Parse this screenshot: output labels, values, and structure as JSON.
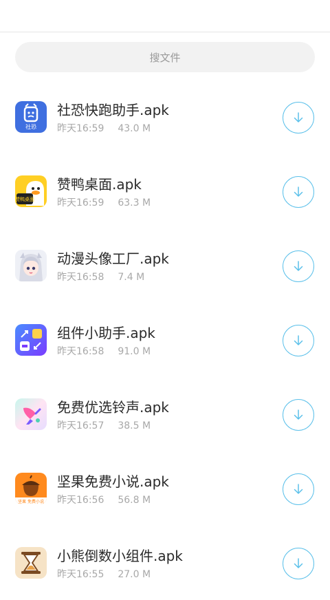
{
  "search": {
    "placeholder": "搜文件"
  },
  "files": [
    {
      "name": "社恐快跑助手.apk",
      "time": "昨天16:59",
      "size": "43.0 M",
      "icon": "shekong-app-icon",
      "icon_text": "社恐"
    },
    {
      "name": "赞鸭桌面.apk",
      "time": "昨天16:59",
      "size": "63.3 M",
      "icon": "zanya-duck-app-icon",
      "icon_text": "赞鸭桌面"
    },
    {
      "name": "动漫头像工厂.apk",
      "time": "昨天16:58",
      "size": "7.4 M",
      "icon": "anime-avatar-app-icon"
    },
    {
      "name": "组件小助手.apk",
      "time": "昨天16:58",
      "size": "91.0 M",
      "icon": "widget-helper-app-icon"
    },
    {
      "name": "免费优选铃声.apk",
      "time": "昨天16:57",
      "size": "38.5 M",
      "icon": "ringtone-app-icon"
    },
    {
      "name": "坚果免费小说.apk",
      "time": "昨天16:56",
      "size": "56.8 M",
      "icon": "nut-novel-app-icon",
      "icon_text": "坚果 免费小说"
    },
    {
      "name": "小熊倒数小组件.apk",
      "time": "昨天16:55",
      "size": "27.0 M",
      "icon": "hourglass-app-icon"
    }
  ],
  "colors": {
    "accent": "#5bc0ea",
    "search_bg": "#f2f2f2"
  }
}
